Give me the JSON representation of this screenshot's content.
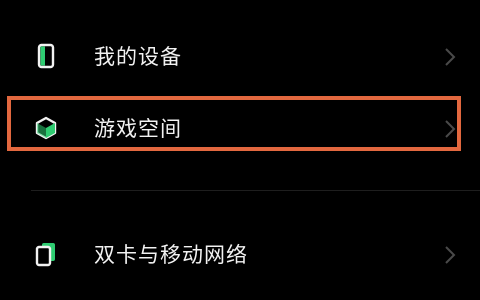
{
  "settings": {
    "items": [
      {
        "label": "我的设备",
        "icon": "phone-device-icon"
      },
      {
        "label": "游戏空间",
        "icon": "game-space-icon"
      },
      {
        "label": "双卡与移动网络",
        "icon": "dual-sim-icon"
      }
    ],
    "highlight_color": "#e2683f",
    "accent_color": "#2ecc71"
  }
}
